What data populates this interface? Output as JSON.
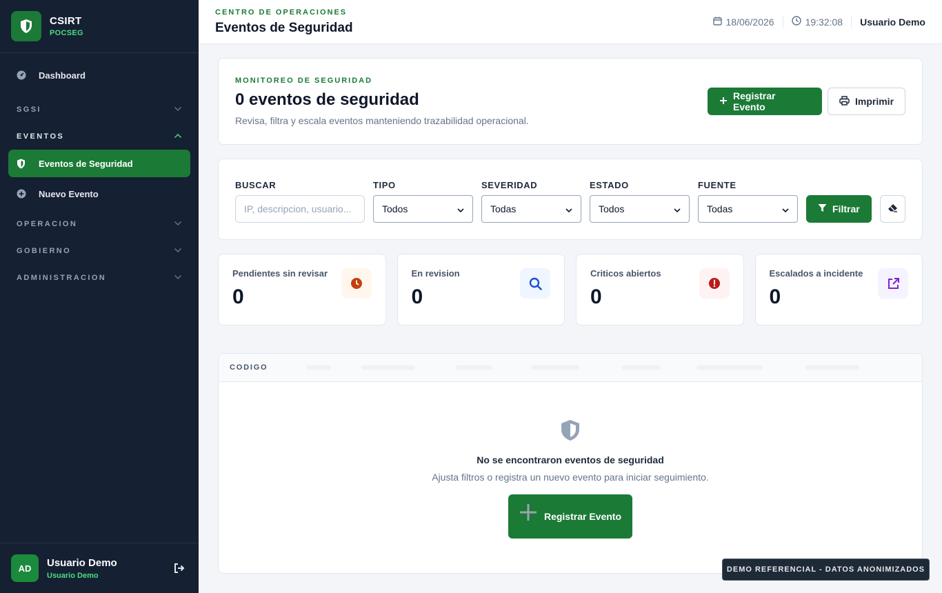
{
  "sidebar": {
    "brand_title": "CSIRT",
    "brand_subtitle": "POCSEG",
    "dashboard_label": "Dashboard",
    "sections": {
      "sgsi": "SGSI",
      "eventos": "EVENTOS",
      "operacion": "OPERACION",
      "gobierno": "GOBIERNO",
      "administracion": "ADMINISTRACION"
    },
    "items": {
      "eventos_seguridad": "Eventos de Seguridad",
      "nuevo_evento": "Nuevo Evento"
    },
    "user": {
      "initials": "AD",
      "name": "Usuario Demo",
      "role": "Usuario Demo"
    }
  },
  "header": {
    "eyebrow": "CENTRO DE OPERACIONES",
    "title": "Eventos de Seguridad",
    "date": "18/06/2026",
    "time": "19:32:08",
    "user": "Usuario Demo"
  },
  "hero": {
    "eyebrow": "MONITOREO DE SEGURIDAD",
    "title": "0 eventos de seguridad",
    "description": "Revisa, filtra y escala eventos manteniendo trazabilidad operacional.",
    "register_label": "Registrar Evento",
    "print_label": "Imprimir"
  },
  "filters": {
    "search_label": "BUSCAR",
    "search_placeholder": "IP, descripcion, usuario...",
    "type_label": "TIPO",
    "type_value": "Todos",
    "severity_label": "SEVERIDAD",
    "severity_value": "Todas",
    "status_label": "ESTADO",
    "status_value": "Todos",
    "source_label": "FUENTE",
    "source_value": "Todas",
    "filter_label": "Filtrar"
  },
  "stats": [
    {
      "label": "Pendientes sin revisar",
      "value": "0",
      "color": "#c2410c",
      "bg": "#fff7ed"
    },
    {
      "label": "En revision",
      "value": "0",
      "color": "#1d4ed8",
      "bg": "#eff6ff"
    },
    {
      "label": "Criticos abiertos",
      "value": "0",
      "color": "#b91c1c",
      "bg": "#fef2f2"
    },
    {
      "label": "Escalados a incidente",
      "value": "0",
      "color": "#7e22ce",
      "bg": "#f5f3ff"
    }
  ],
  "table": {
    "first_column": "CODIGO",
    "empty_title": "No se encontraron eventos de seguridad",
    "empty_description": "Ajusta filtros o registra un nuevo evento para iniciar seguimiento.",
    "empty_button": "Registrar Evento"
  },
  "demo_banner": "DEMO REFERENCIAL - DATOS ANONIMIZADOS",
  "colors": {
    "accent": "#1b7a36",
    "sidebar": "#162033"
  }
}
